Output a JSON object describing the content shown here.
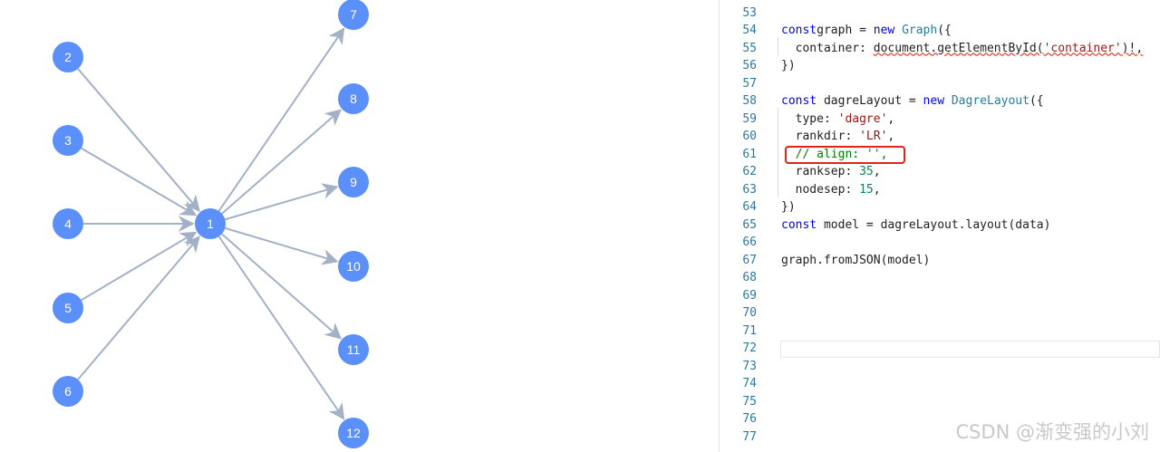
{
  "graph": {
    "nodes": [
      "1",
      "2",
      "3",
      "4",
      "5",
      "6",
      "7",
      "8",
      "9",
      "10",
      "11",
      "12"
    ],
    "node_color": "#5b8ff9",
    "edge_color": "#a3b1c6"
  },
  "editor": {
    "lines": [
      {
        "n": "53",
        "tokens": []
      },
      {
        "n": "54",
        "tokens": [
          [
            "kw",
            "const"
          ],
          [
            "",
            "graph = "
          ],
          [
            "kw",
            "new"
          ],
          [
            "",
            " "
          ],
          [
            "cls",
            "Graph"
          ],
          [
            "",
            "({"
          ]
        ]
      },
      {
        "n": "55",
        "tokens": [
          [
            "",
            "  container: "
          ],
          [
            "sq",
            "document.getElementById("
          ],
          [
            "sqstr",
            "'container'"
          ],
          [
            "sq",
            ")!,"
          ]
        ]
      },
      {
        "n": "56",
        "tokens": [
          [
            "",
            "})"
          ]
        ]
      },
      {
        "n": "57",
        "tokens": []
      },
      {
        "n": "58",
        "tokens": [
          [
            "kw",
            "const"
          ],
          [
            "",
            " dagreLayout = "
          ],
          [
            "kw",
            "new"
          ],
          [
            "",
            " "
          ],
          [
            "cls",
            "DagreLayout"
          ],
          [
            "",
            "({"
          ]
        ]
      },
      {
        "n": "59",
        "tokens": [
          [
            "",
            "  type: "
          ],
          [
            "str",
            "'dagre'"
          ],
          [
            "",
            ","
          ]
        ]
      },
      {
        "n": "60",
        "tokens": [
          [
            "",
            "  rankdir: "
          ],
          [
            "str",
            "'LR'"
          ],
          [
            "",
            ","
          ]
        ]
      },
      {
        "n": "61",
        "tokens": [
          [
            "cmt",
            "  // align: '',"
          ]
        ]
      },
      {
        "n": "62",
        "tokens": [
          [
            "",
            "  ranksep: "
          ],
          [
            "num",
            "35"
          ],
          [
            "",
            ","
          ]
        ]
      },
      {
        "n": "63",
        "tokens": [
          [
            "",
            "  nodesep: "
          ],
          [
            "num",
            "15"
          ],
          [
            "",
            ","
          ]
        ]
      },
      {
        "n": "64",
        "tokens": [
          [
            "",
            "})"
          ]
        ]
      },
      {
        "n": "65",
        "tokens": [
          [
            "kw",
            "const"
          ],
          [
            "",
            " model = dagreLayout.layout(data)"
          ]
        ]
      },
      {
        "n": "66",
        "tokens": []
      },
      {
        "n": "67",
        "tokens": [
          [
            "",
            "graph.fromJSON(model)"
          ]
        ]
      },
      {
        "n": "68",
        "tokens": []
      },
      {
        "n": "69",
        "tokens": []
      },
      {
        "n": "70",
        "tokens": []
      },
      {
        "n": "71",
        "tokens": []
      },
      {
        "n": "72",
        "tokens": []
      },
      {
        "n": "73",
        "tokens": []
      },
      {
        "n": "74",
        "tokens": []
      },
      {
        "n": "75",
        "tokens": []
      },
      {
        "n": "76",
        "tokens": []
      },
      {
        "n": "77",
        "tokens": []
      }
    ]
  },
  "watermark": "CSDN @渐变强的小刘"
}
